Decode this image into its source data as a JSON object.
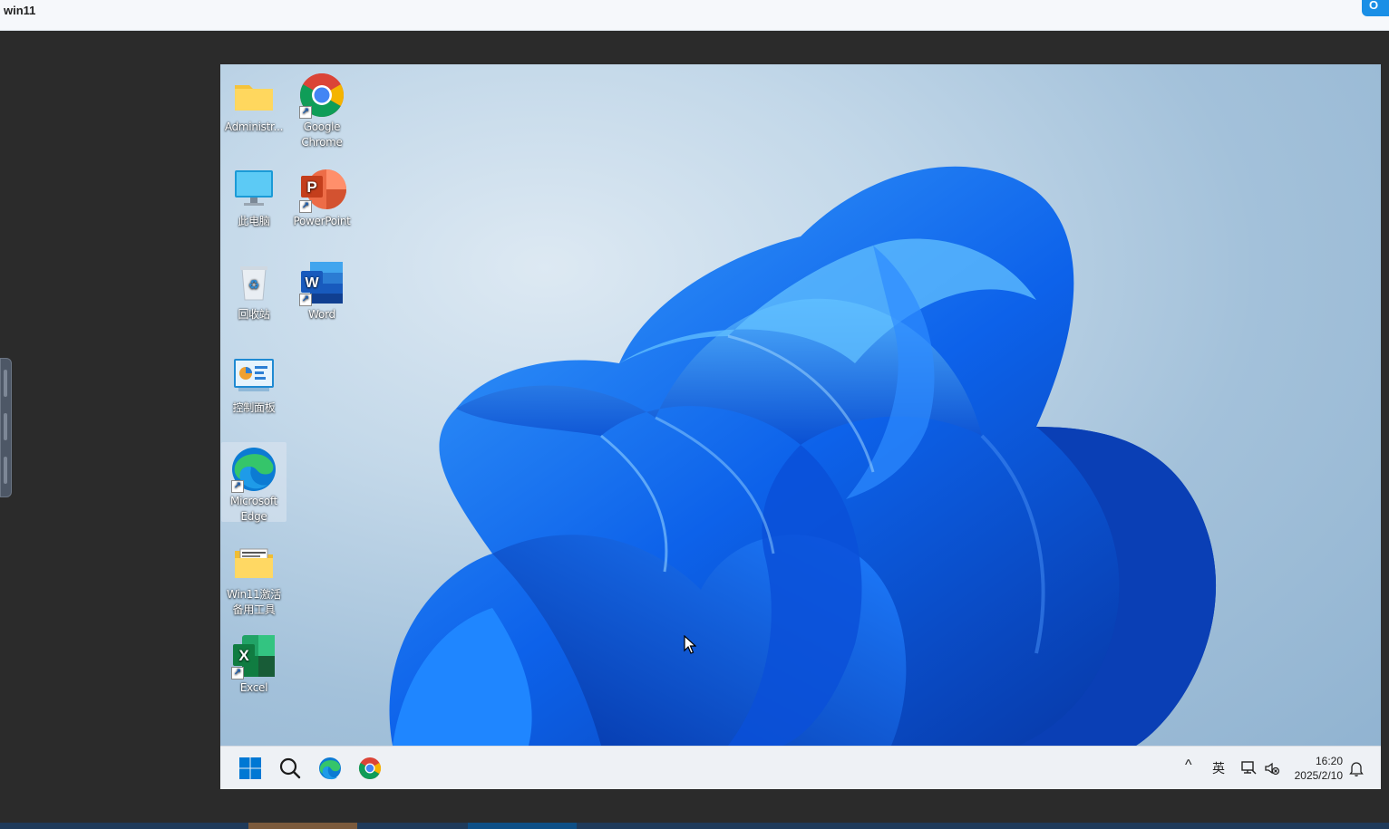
{
  "window": {
    "title": "win11",
    "corner_button": "O"
  },
  "desktop": {
    "icons": [
      {
        "label": "Administr...",
        "icon": "folder-icon"
      },
      {
        "label": "Google Chrome",
        "icon": "chrome-icon"
      },
      {
        "label": "此电脑",
        "icon": "this-pc-icon"
      },
      {
        "label": "PowerPoint",
        "icon": "powerpoint-icon"
      },
      {
        "label": "回收站",
        "icon": "recycle-bin-icon"
      },
      {
        "label": "Word",
        "icon": "word-icon"
      },
      {
        "label": "控制面板",
        "icon": "control-panel-icon"
      },
      {
        "label": "Microsoft Edge",
        "icon": "edge-icon"
      },
      {
        "label": "Win11激活备用工具",
        "icon": "tools-folder-icon"
      },
      {
        "label": "Excel",
        "icon": "excel-icon"
      }
    ]
  },
  "taskbar": {
    "pinned": [
      "start-icon",
      "search-icon",
      "edge-icon",
      "chrome-icon"
    ],
    "tray": {
      "chevron": "^",
      "ime": "英",
      "time": "16:20",
      "date": "2025/2/10"
    }
  },
  "colors": {
    "taskbar_bg": "#eef1f5",
    "bloom_blue": "#0a5ce0",
    "windows_blue": "#0078d4"
  }
}
